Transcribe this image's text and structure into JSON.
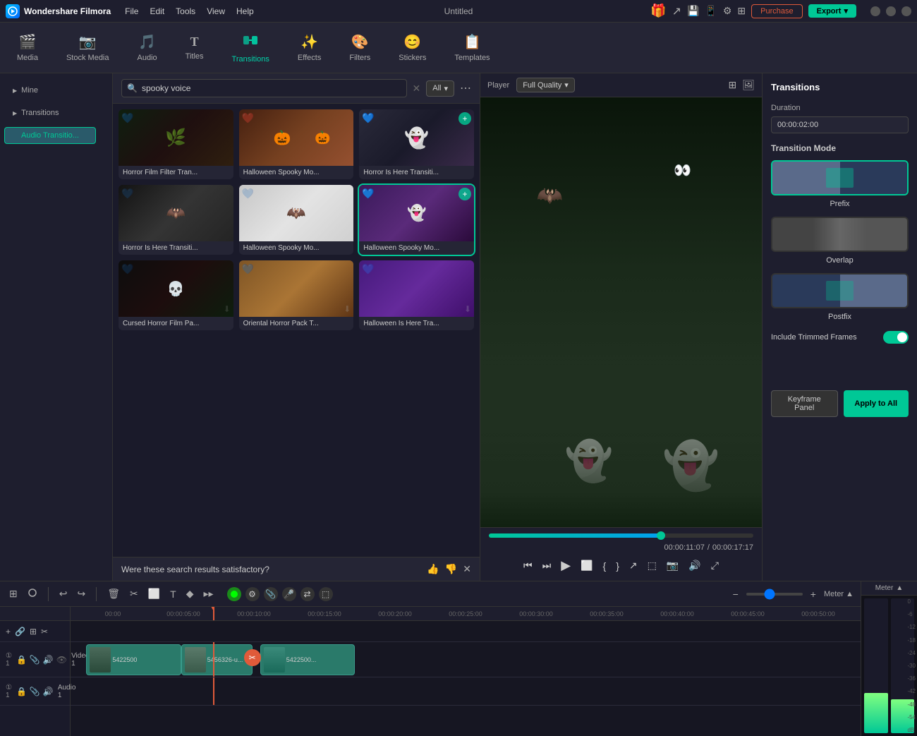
{
  "app": {
    "name": "Wondershare Filmora",
    "title": "Untitled",
    "logo_letter": "F"
  },
  "titlebar": {
    "menu": [
      "File",
      "Edit",
      "Tools",
      "View",
      "Help"
    ],
    "purchase_label": "Purchase",
    "export_label": "Export",
    "export_arrow": "▾"
  },
  "toolbar": {
    "items": [
      {
        "id": "media",
        "label": "Media",
        "icon": "🎬"
      },
      {
        "id": "stock-media",
        "label": "Stock Media",
        "icon": "📷"
      },
      {
        "id": "audio",
        "label": "Audio",
        "icon": "🎵"
      },
      {
        "id": "titles",
        "label": "Titles",
        "icon": "T"
      },
      {
        "id": "transitions",
        "label": "Transitions",
        "icon": "↔",
        "active": true
      },
      {
        "id": "effects",
        "label": "Effects",
        "icon": "✨"
      },
      {
        "id": "filters",
        "label": "Filters",
        "icon": "🎨"
      },
      {
        "id": "stickers",
        "label": "Stickers",
        "icon": "😊"
      },
      {
        "id": "templates",
        "label": "Templates",
        "icon": "📋"
      }
    ]
  },
  "left_panel": {
    "sections": [
      {
        "label": "Mine"
      },
      {
        "label": "Transitions"
      }
    ],
    "active_button": "Audio Transitio..."
  },
  "search": {
    "value": "spooky voice",
    "placeholder": "Search transitions",
    "filter_label": "All",
    "filter_arrow": "▾"
  },
  "grid": {
    "items": [
      {
        "id": 1,
        "label": "Horror Film Filter Tran...",
        "thumb_class": "thumb-horror",
        "badge": "💙",
        "has_add": false
      },
      {
        "id": 2,
        "label": "Halloween Spooky Mo...",
        "thumb_class": "thumb-halloween",
        "badge": "❤️",
        "has_add": false
      },
      {
        "id": 3,
        "label": "Horror Is Here Transiti...",
        "thumb_class": "thumb-spooky",
        "badge": "💙",
        "has_add": true,
        "is_selected": false
      },
      {
        "id": 4,
        "label": "Horror Is Here Transiti...",
        "thumb_class": "thumb-bw",
        "badge": "💙",
        "has_add": false
      },
      {
        "id": 5,
        "label": "Halloween Spooky Mo...",
        "thumb_class": "thumb-white",
        "badge": "💙",
        "has_add": false
      },
      {
        "id": 6,
        "label": "Halloween Spooky Mo...",
        "thumb_class": "thumb-spooky",
        "badge": "💙",
        "has_add": true,
        "is_selected": true
      },
      {
        "id": 7,
        "label": "Cursed Horror Film Pa...",
        "thumb_class": "thumb-film",
        "badge": "💙",
        "has_download": true
      },
      {
        "id": 8,
        "label": "Oriental Horror Pack T...",
        "thumb_class": "thumb-desert",
        "badge": "💙",
        "has_download": true
      },
      {
        "id": 9,
        "label": "Halloween Is Here Tra...",
        "thumb_class": "thumb-purple",
        "badge": "💙",
        "has_download": true
      }
    ]
  },
  "feedback": {
    "text": "Were these search results satisfactory?",
    "thumb_up": "👍",
    "thumb_down": "👎"
  },
  "player": {
    "label": "Player",
    "quality_label": "Full Quality",
    "quality_arrow": "▾",
    "icons": [
      "⊞",
      "🖼"
    ],
    "time_current": "00:00:11:07",
    "time_total": "/ 00:00:17:17",
    "progress_pct": 65
  },
  "controls": {
    "buttons": [
      "⏮",
      "⏭",
      "▶",
      "⬜",
      "{",
      "}",
      "↗",
      "⬚",
      "📷",
      "🔊",
      "⤢"
    ]
  },
  "right_panel": {
    "title": "Transitions",
    "duration_label": "Duration",
    "duration_value": "00:00:02:00",
    "transition_mode_label": "Transition Mode",
    "modes": [
      {
        "id": "prefix",
        "label": "Prefix",
        "selected": true
      },
      {
        "id": "overlap",
        "label": "Overlap",
        "selected": false
      },
      {
        "id": "postfix",
        "label": "Postfix",
        "selected": false
      }
    ],
    "include_trimmed_label": "Include Trimmed Frames",
    "toggle_on": true,
    "keyframe_btn": "Keyframe Panel",
    "apply_btn": "Apply to All"
  },
  "timeline": {
    "toolbar_buttons": [
      "⊞",
      "✂",
      "🗑",
      "✂",
      "⬜",
      "T",
      "⬚",
      "▸"
    ],
    "zoom_label": "Meter",
    "ruler_marks": [
      "00:00",
      "00:00:05:00",
      "00:00:10:00",
      "00:00:15:00",
      "00:00:20:00",
      "00:00:25:00",
      "00:00:30:00",
      "00:00:35:00",
      "00:00:40:00",
      "00:00:45:00",
      "00:00:50:00"
    ],
    "tracks": [
      {
        "id": "video1",
        "label": "Video 1",
        "icons": [
          "🔒",
          "📎",
          "🔊",
          "👁"
        ]
      },
      {
        "id": "audio1",
        "label": "Audio 1",
        "icons": [
          "🔒",
          "📎",
          "🔊"
        ]
      }
    ],
    "clips": [
      {
        "label": "5422500",
        "start_pct": 0,
        "width_pct": 15
      },
      {
        "label": "5456326-u...",
        "start_pct": 15,
        "width_pct": 12
      },
      {
        "label": "5422500...",
        "start_pct": 27,
        "width_pct": 14
      }
    ],
    "playhead_pct": 18,
    "meter": {
      "label": "Meter",
      "scale": [
        "0",
        "-6",
        "-12",
        "-18",
        "-24",
        "-30",
        "-36",
        "-42",
        "-48",
        "-54",
        "dB"
      ]
    }
  }
}
